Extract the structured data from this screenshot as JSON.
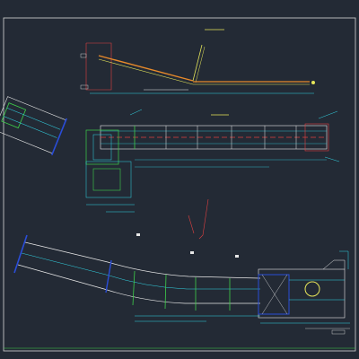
{
  "drawing": {
    "background": "#232a35",
    "border_color": "#d8d8d8",
    "colors": {
      "yellow": "#e6e65a",
      "red": "#e04040",
      "cyan": "#33d6e6",
      "green": "#3ecf4a",
      "blue": "#2a4dd8",
      "white": "#e8e8e8",
      "magenta": "#d84cd8",
      "orange": "#e88a2a"
    },
    "labels": {
      "elevation_view": "",
      "plan_view": "",
      "detail_note": ""
    }
  }
}
